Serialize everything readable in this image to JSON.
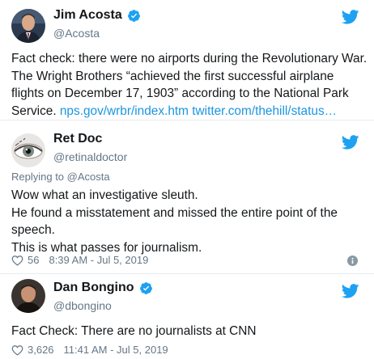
{
  "tweets": [
    {
      "name": "Jim Acosta",
      "handle": "@Acosta",
      "text_lines": [
        "Fact check: there were no airports during the Revolutionary War.",
        "The Wright Brothers “achieved the first successful airplane",
        "flights on December 17, 1903” according to the National Park"
      ],
      "last_line_text": "Service. ",
      "links": [
        "nps.gov/wrbr/index.htm",
        "twitter.com/thehill/status…"
      ]
    },
    {
      "name": "Ret Doc",
      "handle": "@retinaldoctor",
      "reply_to": "Replying to @Acosta",
      "text_lines": [
        "Wow what an investigative sleuth.",
        "He found a misstatement and missed the entire point of the",
        "speech.",
        "This is what passes for journalism."
      ],
      "likes": "56",
      "timestamp": "8:39 AM - Jul 5, 2019"
    },
    {
      "name": "Dan Bongino",
      "handle": "@dbongino",
      "text_lines": [
        "Fact Check: There are no journalists at CNN"
      ],
      "likes": "3,626",
      "timestamp": "11:41 AM - Jul 5, 2019"
    }
  ],
  "icons": {
    "brand": "twitter-bird-icon",
    "verified": "verified-badge-icon",
    "like": "heart-icon",
    "info": "info-icon"
  },
  "colors": {
    "brand_blue": "#1da1f2",
    "link_blue": "#1b95e0",
    "secondary_text": "#657786"
  }
}
